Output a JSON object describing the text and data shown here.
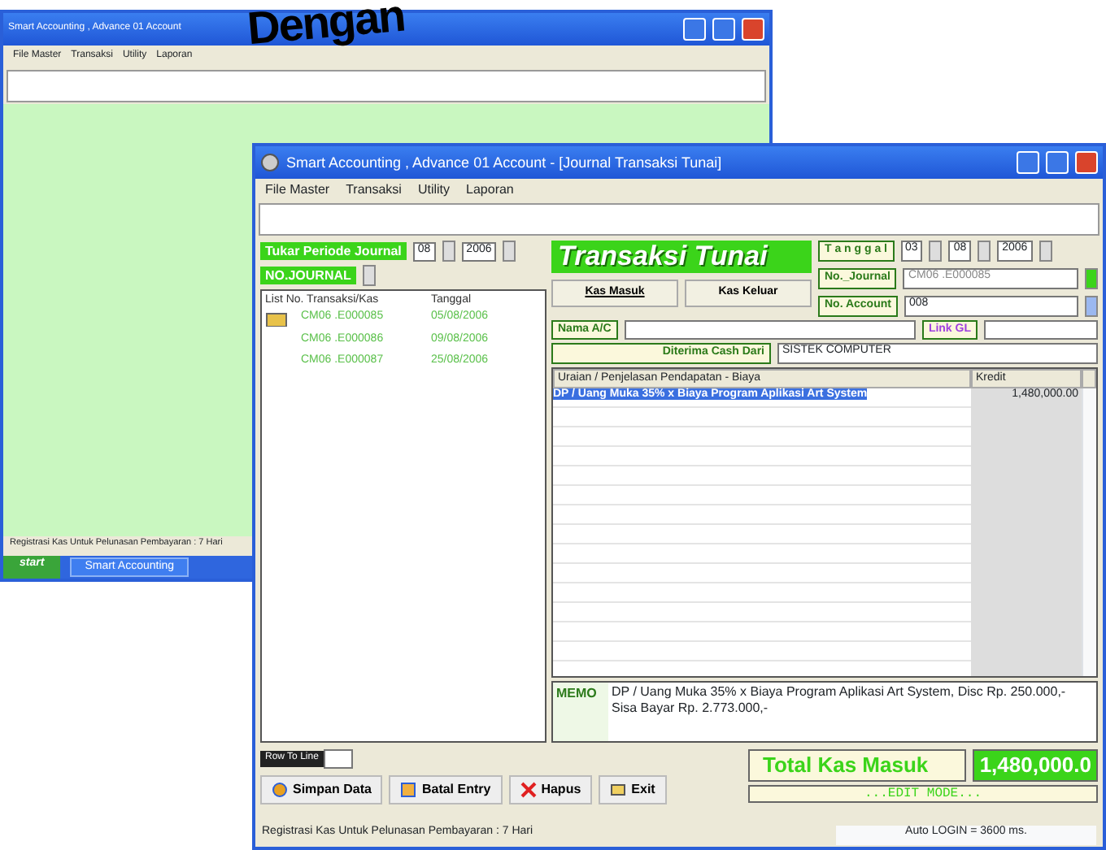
{
  "headline": "Dengan",
  "back_window": {
    "title": "Smart Accounting , Advance 01 Account",
    "menu": [
      "File Master",
      "Transaksi",
      "Utility",
      "Laporan"
    ],
    "status_bar": "Registrasi Kas Untuk Pelunasan Pembayaran : 7 Hari",
    "taskbar": {
      "start": "start",
      "tasks": [
        "Smart Accounting"
      ]
    }
  },
  "front_window": {
    "title": "Smart Accounting , Advance 01 Account - [Journal Transaksi Tunai]",
    "menu": [
      "File Master",
      "Transaksi",
      "Utility",
      "Laporan"
    ],
    "period": {
      "label": "Tukar Periode Journal",
      "month": "08",
      "year": "2006"
    },
    "journal_label": "NO.JOURNAL",
    "list": {
      "columns": [
        "List No. Transaksi/Kas",
        "Tanggal"
      ],
      "rows": [
        {
          "number": "CM06 .E000085",
          "date": "05/08/2006"
        },
        {
          "number": "CM06 .E000086",
          "date": "09/08/2006"
        },
        {
          "number": "CM06 .E000087",
          "date": "25/08/2006"
        }
      ]
    },
    "heading": "Transaksi Tunai",
    "modes": [
      {
        "label": "Kas Masuk",
        "selected": true
      },
      {
        "label": "Kas Keluar",
        "selected": false
      }
    ],
    "date": {
      "label": "T a n g g a l",
      "day": "03",
      "month": "08",
      "year": "2006"
    },
    "journal_no": {
      "label": "No._Journal",
      "value": "CM06 .E000085"
    },
    "account_no": {
      "label": "No. Account",
      "value": "008"
    },
    "account_name": {
      "label": "Nama A/C"
    },
    "link_gl": {
      "label": "Link GL"
    },
    "received_from": {
      "label": "Diterima Cash Dari",
      "value": "SISTEK COMPUTER"
    },
    "table": {
      "columns": [
        "Uraian / Penjelasan Pendapatan - Biaya",
        "Kredit"
      ],
      "rows": [
        {
          "description": "DP / Uang Muka 35% x Biaya Program Aplikasi Art System",
          "credit": "1,480,000.00",
          "selected": true
        }
      ]
    },
    "memo": {
      "label": "MEMO",
      "text": "DP / Uang Muka 35% x Biaya Program Aplikasi Art System, Disc Rp. 250.000,- Sisa Bayar Rp. 2.773.000,-"
    },
    "row_to_line": "Row To Line",
    "buttons": [
      {
        "kind": "save",
        "label": "Simpan Data"
      },
      {
        "kind": "cancel",
        "label": "Batal Entry"
      },
      {
        "kind": "delete",
        "label": "Hapus"
      },
      {
        "kind": "exit",
        "label": "Exit"
      }
    ],
    "total": {
      "label": "Total Kas Masuk",
      "value": "1,480,000.0"
    },
    "mode_text": "...EDIT MODE...",
    "status_bar": [
      "Registrasi Kas Untuk Pelunasan Pembayaran : 7 Hari",
      "Auto LOGIN = 3600 ms."
    ]
  }
}
